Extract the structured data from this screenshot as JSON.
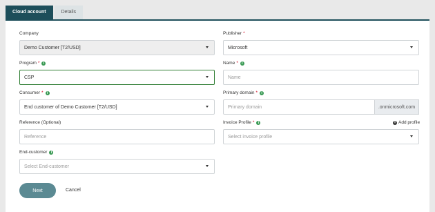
{
  "tabs": {
    "active": "Cloud account",
    "inactive": "Details"
  },
  "form": {
    "company": {
      "label": "Company",
      "value": "Demo Customer [T2/USD]"
    },
    "publisher": {
      "label": "Publisher",
      "required": "*",
      "value": "Microsoft"
    },
    "program": {
      "label": "Program",
      "required": "*",
      "value": "CSP"
    },
    "name": {
      "label": "Name",
      "required": "*",
      "placeholder": "Name"
    },
    "consumer": {
      "label": "Consumer",
      "required": "*",
      "value": "End customer of Demo Customer [T2/USD]"
    },
    "primary_domain": {
      "label": "Primary domain",
      "required": "*",
      "placeholder": "Primary domain",
      "suffix": ".onmicrosoft.com"
    },
    "reference": {
      "label": "Reference (Optional)",
      "placeholder": "Reference"
    },
    "invoice_profile": {
      "label": "Invoice Profile",
      "required": "*",
      "placeholder": "Select invoice profile",
      "add_label": "Add profile"
    },
    "end_customer": {
      "label": "End-customer",
      "placeholder": "Select End-customer"
    }
  },
  "icons": {
    "info": "info-icon",
    "caret": "caret-down-icon",
    "add": "plus-circle-icon"
  },
  "actions": {
    "next": "Next",
    "cancel": "Cancel"
  },
  "colors": {
    "accent": "#1d4e5a",
    "info": "#3a9a54",
    "required": "#d0021b",
    "button": "#5b8a93"
  }
}
